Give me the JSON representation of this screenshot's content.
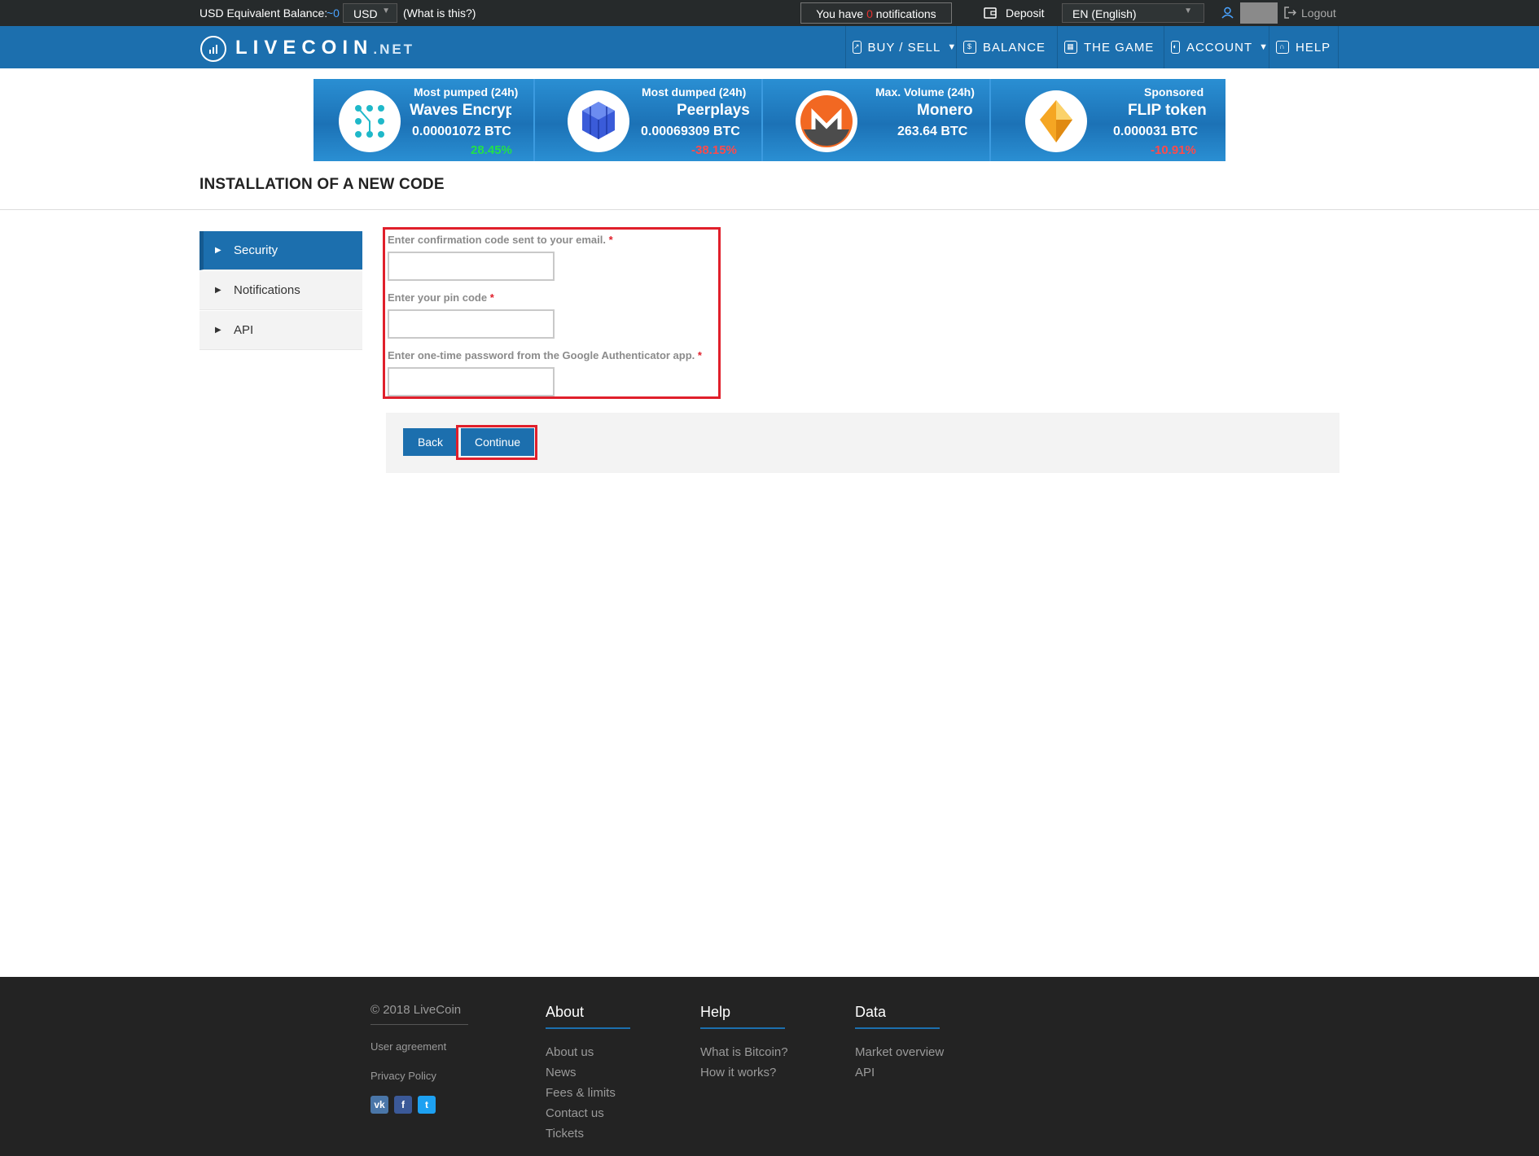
{
  "topbar": {
    "balance_label": "USD Equivalent Balance:",
    "balance_value": "~0",
    "currency": "USD",
    "what_is_this": "(What is this?)",
    "notif_prefix": "You have",
    "notif_count": "0",
    "notif_suffix": "notifications",
    "deposit": "Deposit",
    "language": "EN (English)",
    "logout": "Logout"
  },
  "brand": {
    "logo_main": "LIVECOIN",
    "logo_suffix": ".NET"
  },
  "nav": {
    "buy_sell": "BUY / SELL",
    "balance": "BALANCE",
    "the_game": "THE GAME",
    "account": "ACCOUNT",
    "help": "HELP"
  },
  "ticker": [
    {
      "heading": "Most pumped (24h)",
      "name": "Waves Encryptc",
      "price": "0.00001072 BTC",
      "change": "28.45%",
      "direction": "up"
    },
    {
      "heading": "Most dumped (24h)",
      "name": "Peerplays",
      "price": "0.00069309 BTC",
      "change": "-38.15%",
      "direction": "down"
    },
    {
      "heading": "Max. Volume (24h)",
      "name": "Monero",
      "price": "263.64 BTC",
      "change": "",
      "direction": "none"
    },
    {
      "heading": "Sponsored",
      "name": "FLIP token",
      "price": "0.000031 BTC",
      "change": "-10.91%",
      "direction": "down"
    }
  ],
  "page": {
    "title": "INSTALLATION OF A NEW CODE"
  },
  "sidebar": {
    "items": [
      {
        "label": "Security",
        "active": true
      },
      {
        "label": "Notifications",
        "active": false
      },
      {
        "label": "API",
        "active": false
      }
    ]
  },
  "form": {
    "email_code_label": "Enter confirmation code sent to your email.",
    "pin_label": "Enter your pin code",
    "otp_label": "Enter one-time password from the Google Authenticator app.",
    "required_mark": "*",
    "email_code_value": "",
    "pin_value": "",
    "otp_value": "",
    "back": "Back",
    "continue": "Continue"
  },
  "footer": {
    "copyright": "© 2018 LiveCoin",
    "user_agreement": "User agreement",
    "privacy_policy": "Privacy Policy",
    "about": {
      "heading": "About",
      "links": [
        "About us",
        "News",
        "Fees & limits",
        "Contact us",
        "Tickets"
      ]
    },
    "help": {
      "heading": "Help",
      "links": [
        "What is Bitcoin?",
        "How it works?"
      ]
    },
    "data": {
      "heading": "Data",
      "links": [
        "Market overview",
        "API"
      ]
    }
  },
  "colors": {
    "brand_blue": "#1c6fae",
    "topbar_bg": "#262a2b",
    "highlight_red": "#e01f2b",
    "up_green": "#22e04a",
    "down_red": "#ff4a4a"
  }
}
